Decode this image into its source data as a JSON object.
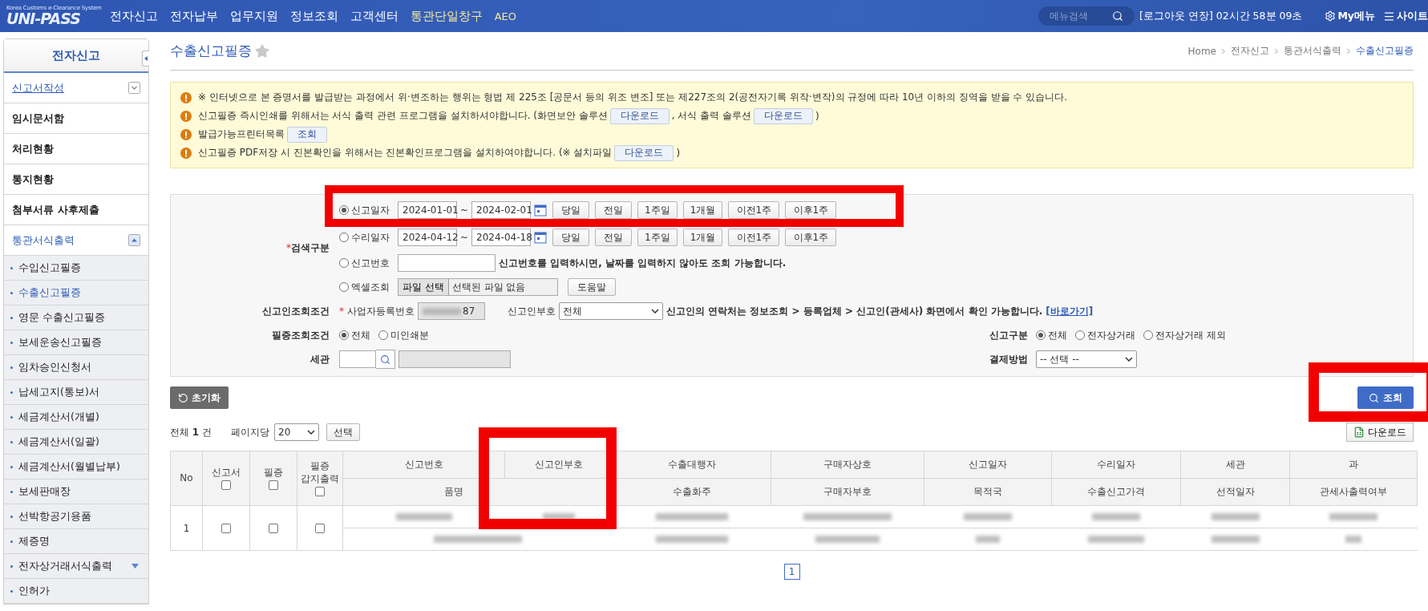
{
  "header": {
    "logo": {
      "subtitle": "Korea Customs e-Clearance System",
      "title": "UNI-PASS"
    },
    "nav": [
      {
        "label": "전자신고",
        "highlighted": false
      },
      {
        "label": "전자납부",
        "highlighted": false
      },
      {
        "label": "업무지원",
        "highlighted": false
      },
      {
        "label": "정보조회",
        "highlighted": false
      },
      {
        "label": "고객센터",
        "highlighted": false
      },
      {
        "label": "통관단일창구",
        "highlighted": true
      },
      {
        "label": "AEO",
        "highlighted": true
      }
    ],
    "menu_search": {
      "placeholder": "메뉴검색"
    },
    "session": "[로그아웃 연장] 02시간 58분 09초",
    "my_menu": "My메뉴",
    "sitemap": "사이트"
  },
  "sidebar": {
    "title": "전자신고",
    "items": [
      {
        "label": "신고서작성",
        "kind": "main",
        "active": true,
        "link": true,
        "expanded": false
      },
      {
        "label": "임시문서함",
        "kind": "main",
        "active": false,
        "link": false
      },
      {
        "label": "처리현황",
        "kind": "main",
        "active": false,
        "link": false
      },
      {
        "label": "통지현황",
        "kind": "main",
        "active": false,
        "link": false
      },
      {
        "label": "첨부서류 사후제출",
        "kind": "main",
        "active": false,
        "link": false
      },
      {
        "label": "통관서식출력",
        "kind": "main",
        "active": true,
        "link": false,
        "expanded": true
      },
      {
        "label": "수입신고필증",
        "kind": "sub",
        "selected": false
      },
      {
        "label": "수출신고필증",
        "kind": "sub",
        "selected": true
      },
      {
        "label": "영문 수출신고필증",
        "kind": "sub",
        "selected": false
      },
      {
        "label": "보세운송신고필증",
        "kind": "sub",
        "selected": false
      },
      {
        "label": "임차승인신청서",
        "kind": "sub",
        "selected": false
      },
      {
        "label": "납세고지(통보)서",
        "kind": "sub",
        "selected": false
      },
      {
        "label": "세금계산서(개별)",
        "kind": "sub",
        "selected": false
      },
      {
        "label": "세금계산서(일괄)",
        "kind": "sub",
        "selected": false
      },
      {
        "label": "세금계산서(월별납부)",
        "kind": "sub",
        "selected": false
      },
      {
        "label": "보세판매장",
        "kind": "sub",
        "selected": false
      },
      {
        "label": "선박항공기용품",
        "kind": "sub",
        "selected": false
      },
      {
        "label": "제증명",
        "kind": "sub",
        "selected": false
      },
      {
        "label": "전자상거래서식출력",
        "kind": "sub",
        "selected": false,
        "expanded": false
      },
      {
        "label": "인허가",
        "kind": "sub",
        "selected": false
      }
    ]
  },
  "page": {
    "title": "수출신고필증",
    "starred": false,
    "breadcrumb": [
      {
        "label": "Home",
        "current": false
      },
      {
        "label": "전자신고",
        "current": false
      },
      {
        "label": "통관서식출력",
        "current": false
      },
      {
        "label": "수출신고필증",
        "current": true
      }
    ]
  },
  "notices": [
    [
      {
        "kind": "text",
        "text": "※ 인터넷으로 본 증명서를 발급받는 과정에서 위·변조하는 행위는 형법 제 225조 [공문서 등의 위조 변조] 또는 제227조의 2(공전자기록 위작·변작)의 규정에 따라 10년 이하의 징역을 받을 수 있습니다."
      }
    ],
    [
      {
        "kind": "text",
        "text": "신고필증 즉시인쇄를 위해서는 서식 출력 관련 프로그램을 설치하셔야합니다. (화면보안 솔루션"
      },
      {
        "kind": "button",
        "text": "다운로드"
      },
      {
        "kind": "text",
        "text": ", 서식 출력 솔루션"
      },
      {
        "kind": "button",
        "text": "다운로드"
      },
      {
        "kind": "text",
        "text": ")"
      }
    ],
    [
      {
        "kind": "text",
        "text": "발급가능프린터목록"
      },
      {
        "kind": "button",
        "text": "조회"
      }
    ],
    [
      {
        "kind": "text",
        "text": "신고필증 PDF저장 시 진본확인을 위해서는 진본확인프로그램을 설치하여야합니다. (※ 설치파일"
      },
      {
        "kind": "button",
        "text": "다운로드"
      },
      {
        "kind": "text",
        "text": ")"
      }
    ]
  ],
  "search_form": {
    "search_type": {
      "label": "검색구분",
      "required_mark": "*",
      "options": [
        {
          "kind": "date_range",
          "label": "신고일자",
          "selected": true,
          "from": "2024-01-01",
          "separator": "~",
          "to": "2024-02-01",
          "quick": [
            "당일",
            "전일",
            "1주일",
            "1개월",
            "이전1주",
            "이후1주"
          ]
        },
        {
          "kind": "date_range",
          "label": "수리일자",
          "selected": false,
          "from": "2024-04-12",
          "separator": "~",
          "to": "2024-04-18",
          "quick": [
            "당일",
            "전일",
            "1주일",
            "1개월",
            "이전1주",
            "이후1주"
          ]
        },
        {
          "kind": "number",
          "label": "신고번호",
          "selected": false,
          "note": "신고번호를 입력하시면, 날짜를 입력하지 않아도 조회 가능합니다."
        },
        {
          "kind": "excel",
          "label": "엑셀조회",
          "selected": false,
          "file_button": "파일 선택",
          "file_status": "선택된 파일 없음",
          "help": "도움말"
        }
      ]
    },
    "declarant": {
      "label": "신고인조회조건",
      "business_no": {
        "required_mark": "*",
        "label": "사업자등록번호",
        "visible_digits": "87"
      },
      "code": {
        "label": "신고인부호",
        "value": "전체"
      },
      "note": "신고인의 연락처는 정보조회 > 등록업체 > 신고인(관세사) 화면에서 확인 가능합니다.",
      "link": "[바로가기]"
    },
    "certificate": {
      "label": "필증조회조건",
      "options": [
        {
          "label": "전체",
          "selected": true
        },
        {
          "label": "미인쇄분",
          "selected": false
        }
      ]
    },
    "declaration_type": {
      "label": "신고구분",
      "options": [
        {
          "label": "전체",
          "selected": true
        },
        {
          "label": "전자상거래",
          "selected": false
        },
        {
          "label": "전자상거래 제외",
          "selected": false
        }
      ]
    },
    "customs": {
      "label": "세관"
    },
    "payment": {
      "label": "결제방법",
      "value": "-- 선택 --"
    }
  },
  "actions": {
    "reset": "초기화",
    "search": "조회"
  },
  "results": {
    "total": "전체 **1** 건",
    "per_page_label": "페이지당",
    "per_page": "20",
    "apply": "선택",
    "download": "다운로드"
  },
  "table": {
    "fixed_columns": [
      {
        "label": "No",
        "checkbox": false
      },
      {
        "label": "신고서",
        "checkbox": true,
        "checked": false
      },
      {
        "label": "필증",
        "checkbox": true,
        "checked": false
      },
      {
        "label": "필증 갑지출력",
        "checkbox": true,
        "checked": false
      }
    ],
    "header_top": [
      "신고번호",
      "신고인부호",
      "수출대행자",
      "구매자상호",
      "신고일자",
      "수리일자",
      "세관",
      "과"
    ],
    "header_bottom": [
      "품명",
      "수출화주",
      "구매자부호",
      "목적국",
      "수출신고가격",
      "선적일자",
      "관세사출력여부"
    ],
    "rows": [
      {
        "no": "1",
        "checks": [
          false,
          false,
          false
        ]
      }
    ]
  },
  "pagination": [
    {
      "label": "1",
      "selected": true
    }
  ]
}
